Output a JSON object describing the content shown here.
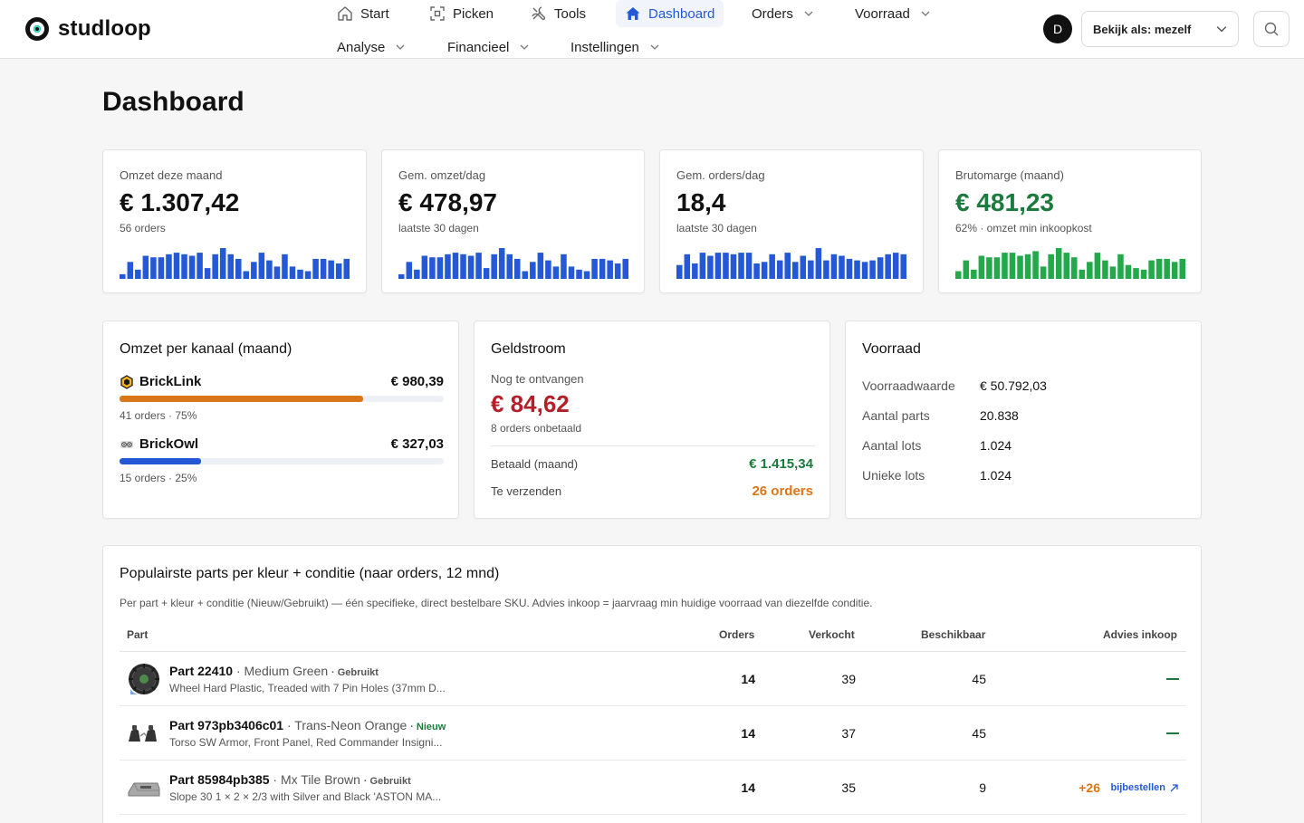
{
  "brand": {
    "name": "studloop"
  },
  "nav": {
    "row1": [
      {
        "label": "Start",
        "icon": "home-outline-icon"
      },
      {
        "label": "Picken",
        "icon": "scan-icon"
      },
      {
        "label": "Tools",
        "icon": "tools-icon"
      },
      {
        "label": "Dashboard",
        "icon": "home-filled-icon",
        "active": true
      },
      {
        "label": "Orders",
        "icon": "chevron-down-icon"
      },
      {
        "label": "Voorraad",
        "icon": "chevron-down-icon"
      }
    ],
    "row2": [
      {
        "label": "Analyse"
      },
      {
        "label": "Financieel"
      },
      {
        "label": "Instellingen"
      }
    ]
  },
  "user": {
    "initial": "D",
    "view_as": "Bekijk als: mezelf"
  },
  "page": {
    "title": "Dashboard"
  },
  "kpis": [
    {
      "label": "Omzet deze maand",
      "value": "€ 1.307,42",
      "sub": "56 orders",
      "color": "#2458d6",
      "bars": [
        0.15,
        0.55,
        0.3,
        0.75,
        0.7,
        0.7,
        0.8,
        0.85,
        0.8,
        0.75,
        0.85,
        0.35,
        0.8,
        1.0,
        0.8,
        0.65,
        0.25,
        0.55,
        0.85,
        0.6,
        0.4,
        0.8,
        0.4,
        0.3,
        0.25,
        0.65,
        0.65,
        0.6,
        0.5,
        0.65
      ]
    },
    {
      "label": "Gem. omzet/dag",
      "value": "€ 478,97",
      "sub": "laatste 30 dagen",
      "color": "#2458d6",
      "bars": [
        0.15,
        0.55,
        0.3,
        0.75,
        0.7,
        0.7,
        0.8,
        0.85,
        0.8,
        0.75,
        0.85,
        0.35,
        0.8,
        1.0,
        0.8,
        0.65,
        0.25,
        0.55,
        0.85,
        0.6,
        0.4,
        0.8,
        0.4,
        0.3,
        0.25,
        0.65,
        0.65,
        0.6,
        0.5,
        0.65
      ]
    },
    {
      "label": "Gem. orders/dag",
      "value": "18,4",
      "sub": "laatste 30 dagen",
      "color": "#2458d6",
      "bars": [
        0.45,
        0.8,
        0.5,
        0.85,
        0.75,
        0.85,
        0.85,
        0.8,
        0.85,
        0.85,
        0.5,
        0.55,
        0.8,
        0.6,
        0.85,
        0.55,
        0.75,
        0.6,
        1.0,
        0.6,
        0.8,
        0.75,
        0.65,
        0.6,
        0.55,
        0.6,
        0.7,
        0.8,
        0.85,
        0.8
      ]
    },
    {
      "label": "Brutomarge (maand)",
      "value": "€ 481,23",
      "sub": "62% · omzet min inkoopkost",
      "color": "#23a94a",
      "bars": [
        0.25,
        0.6,
        0.3,
        0.75,
        0.7,
        0.7,
        0.85,
        0.85,
        0.75,
        0.8,
        0.9,
        0.4,
        0.8,
        1.0,
        0.85,
        0.7,
        0.3,
        0.55,
        0.85,
        0.6,
        0.4,
        0.8,
        0.45,
        0.35,
        0.3,
        0.6,
        0.65,
        0.65,
        0.55,
        0.65
      ]
    }
  ],
  "channels": {
    "title": "Omzet per kanaal (maand)",
    "items": [
      {
        "name": "BrickLink",
        "amount": "€ 980,39",
        "meta": "41 orders · 75%",
        "share": 0.75,
        "color": "#d9761a",
        "icon": "bricklink-logo-icon"
      },
      {
        "name": "BrickOwl",
        "amount": "€ 327,03",
        "meta": "15 orders · 25%",
        "share": 0.25,
        "color": "#2458d6",
        "icon": "brickowl-logo-icon"
      }
    ]
  },
  "geldstroom": {
    "title": "Geldstroom",
    "label": "Nog te ontvangen",
    "value": "€ 84,62",
    "sub": "8 orders onbetaald",
    "rows": [
      {
        "label": "Betaald (maand)",
        "value": "€ 1.415,34",
        "color": "#1b7a3c"
      },
      {
        "label": "Te verzenden",
        "value": "26 orders",
        "color": "#d9761a"
      }
    ]
  },
  "voorraad": {
    "title": "Voorraad",
    "rows": [
      {
        "label": "Voorraadwaarde",
        "value": "€ 50.792,03"
      },
      {
        "label": "Aantal parts",
        "value": "20.838"
      },
      {
        "label": "Aantal lots",
        "value": "1.024"
      },
      {
        "label": "Unieke lots",
        "value": "1.024"
      }
    ]
  },
  "popular": {
    "title": "Populairste parts per kleur + conditie (naar orders, 12 mnd)",
    "description": "Per part + kleur + conditie (Nieuw/Gebruikt) — één specifieke, direct bestelbare SKU. Advies inkoop = jaarvraag min huidige voorraad van diezelfde conditie.",
    "columns": {
      "part": "Part",
      "orders": "Orders",
      "verkocht": "Verkocht",
      "beschikbaar": "Beschikbaar",
      "advies": "Advies inkoop"
    },
    "rows": [
      {
        "part": "Part 22410",
        "color": "Medium Green",
        "condition": "Gebruikt",
        "is_new": false,
        "description": "Wheel Hard Plastic, Treaded with 7 Pin Holes (37mm D...",
        "orders": "14",
        "verkocht": "39",
        "beschikbaar": "45",
        "advies": "—",
        "thumb": "wheel-thumbnail"
      },
      {
        "part": "Part 973pb3406c01",
        "color": "Trans-Neon Orange",
        "condition": "Nieuw",
        "is_new": true,
        "description": "Torso SW Armor, Front Panel, Red Commander Insigni...",
        "orders": "14",
        "verkocht": "37",
        "beschikbaar": "45",
        "advies": "—",
        "thumb": "torso-thumbnail"
      },
      {
        "part": "Part 85984pb385",
        "color": "Mx Tile Brown",
        "condition": "Gebruikt",
        "is_new": false,
        "description": "Slope 30 1 × 2 × 2/3 with Silver and Black 'ASTON MA...",
        "orders": "14",
        "verkocht": "35",
        "beschikbaar": "9",
        "advies": "+26",
        "advies_link": "bijbestellen",
        "thumb": "slope-thumbnail"
      }
    ]
  }
}
